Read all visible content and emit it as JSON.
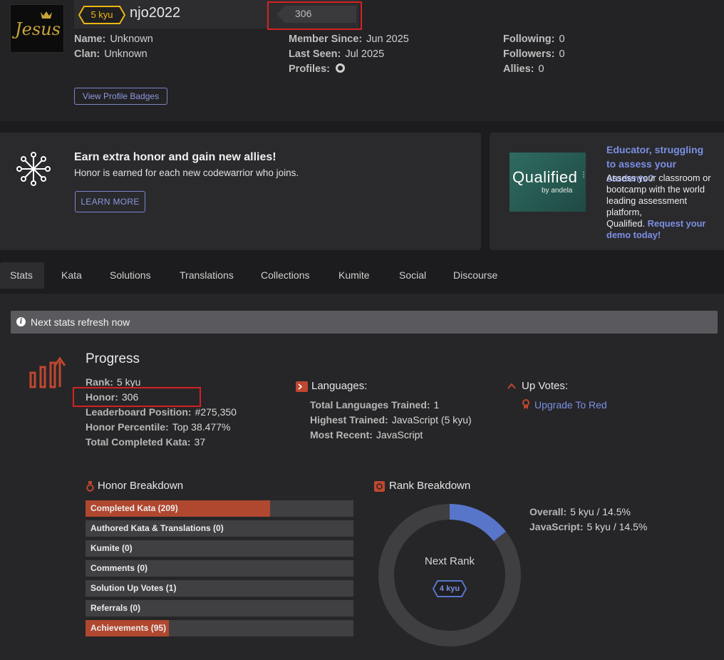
{
  "profile": {
    "rank": "5 kyu",
    "username": "njo2022",
    "honor": "306",
    "avatar_text": "Jesus",
    "name_label": "Name:",
    "name_value": "Unknown",
    "clan_label": "Clan:",
    "clan_value": "Unknown",
    "member_since_label": "Member Since:",
    "member_since_value": "Jun 2025",
    "last_seen_label": "Last Seen:",
    "last_seen_value": "Jul 2025",
    "profiles_label": "Profiles:",
    "following_label": "Following:",
    "following_value": "0",
    "followers_label": "Followers:",
    "followers_value": "0",
    "allies_label": "Allies:",
    "allies_value": "0",
    "badges_button": "View Profile Badges",
    "rank_color": "#ecb613"
  },
  "promo": {
    "title": "Earn extra honor and gain new allies!",
    "text": "Honor is earned for each new codewarrior who joins.",
    "button": "LEARN MORE"
  },
  "qualified": {
    "logo": "Qualified",
    "logo_sub": "by andela",
    "headline": "Educator, struggling to assess your students?",
    "body": "Assess your classroom or bootcamp with the world leading assessment platform,",
    "body2": "Qualified.",
    "link": "Request your demo today!"
  },
  "tabs": [
    "Stats",
    "Kata",
    "Solutions",
    "Translations",
    "Collections",
    "Kumite",
    "Social",
    "Discourse"
  ],
  "notice": "Next stats refresh now",
  "progress": {
    "title": "Progress",
    "rank_label": "Rank:",
    "rank_value": "5 kyu",
    "honor_label": "Honor:",
    "honor_value": "306",
    "leaderboard_label": "Leaderboard Position:",
    "leaderboard_value": "#275,350",
    "percentile_label": "Honor Percentile:",
    "percentile_value": "Top 38.477%",
    "completed_label": "Total Completed Kata:",
    "completed_value": "37"
  },
  "languages": {
    "title": "Languages:",
    "total_label": "Total Languages Trained:",
    "total_value": "1",
    "highest_label": "Highest Trained:",
    "highest_value": "JavaScript (5 kyu)",
    "recent_label": "Most Recent:",
    "recent_value": "JavaScript"
  },
  "upvotes": {
    "title": "Up Votes:",
    "link": "Upgrade To Red"
  },
  "honor_breakdown": {
    "title": "Honor Breakdown",
    "items": [
      {
        "label": "Completed Kata (209)",
        "fill": 0.688
      },
      {
        "label": "Authored Kata & Translations (0)",
        "fill": 0
      },
      {
        "label": "Kumite (0)",
        "fill": 0
      },
      {
        "label": "Comments (0)",
        "fill": 0
      },
      {
        "label": "Solution Up Votes (1)",
        "fill": 0
      },
      {
        "label": "Referrals (0)",
        "fill": 0
      },
      {
        "label": "Achievements (95)",
        "fill": 0.31
      }
    ]
  },
  "rank_breakdown": {
    "title": "Rank Breakdown",
    "center_label": "Next Rank",
    "next_rank": "4 kyu",
    "progress_percent": 14.5,
    "overall_label": "Overall:",
    "overall_value": "5 kyu / 14.5%",
    "js_label": "JavaScript:",
    "js_value": "5 kyu / 14.5%"
  },
  "colors": {
    "accent": "#7b8fe4",
    "honor_fill": "#b0472f",
    "highlight": "#d32222"
  }
}
